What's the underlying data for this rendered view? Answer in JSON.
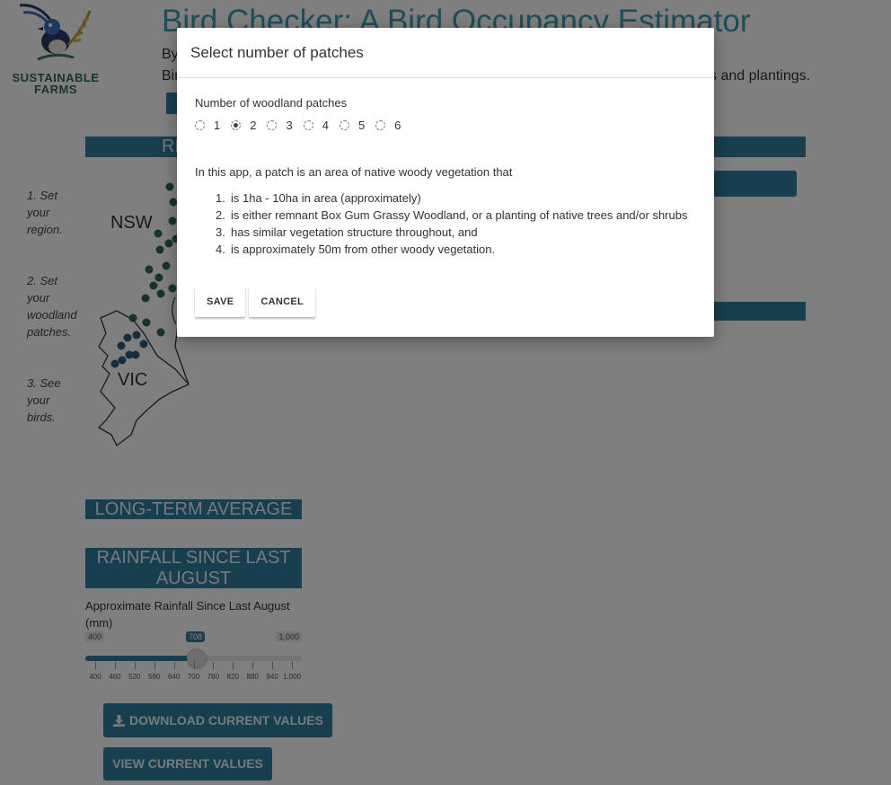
{
  "logo": {
    "text_line1": "SUSTAINABLE",
    "text_line2": "FARMS"
  },
  "header": {
    "title": "Bird Checker: A Bird Occupancy Estimator",
    "by_prefix": "By",
    "intro_prefix": "Bir",
    "intro_suffix": "s and plantings."
  },
  "region_bar": {
    "label": "RE"
  },
  "steps": [
    {
      "text": "1. Set your region."
    },
    {
      "text": "2. Set your woodland patches."
    },
    {
      "text": "3. See your birds."
    }
  ],
  "map": {
    "label_nsw": "NSW",
    "label_vic": "VIC"
  },
  "rainfall": {
    "lta_title": "LONG-TERM AVERAGE",
    "since_title": "RAINFALL SINCE LAST AUGUST",
    "slider_label": "Approximate Rainfall Since Last August (mm)",
    "min_label": "400",
    "max_label": "1,000",
    "min": 400,
    "max": 1000,
    "value": 708,
    "value_label": "708",
    "ticks": [
      "400",
      "460",
      "520",
      "580",
      "640",
      "700",
      "760",
      "820",
      "880",
      "940",
      "1,000"
    ]
  },
  "buttons": {
    "download_label": "DOWNLOAD CURRENT VALUES",
    "view_label": "VIEW CURRENT VALUES"
  },
  "modal": {
    "title": "Select number of patches",
    "field_label": "Number of woodland patches",
    "options": [
      "1",
      "2",
      "3",
      "4",
      "5",
      "6"
    ],
    "selected": "2",
    "definition_intro": "In this app, a patch is an area of native woody vegetation that",
    "definitions": [
      "is 1ha - 10ha in area (approximately)",
      "is either remnant Box Gum Grassy Woodland, or a planting of native trees and/or shrubs",
      "has similar vegetation structure throughout, and",
      "is approximately 50m from other woody vegetation."
    ],
    "save_label": "SAVE",
    "cancel_label": "CANCEL"
  },
  "colors": {
    "accent": "#2e7fa0",
    "title": "#3a9cb8",
    "dot_green": "#2e6b4f",
    "dot_blue": "#2b5a78"
  }
}
